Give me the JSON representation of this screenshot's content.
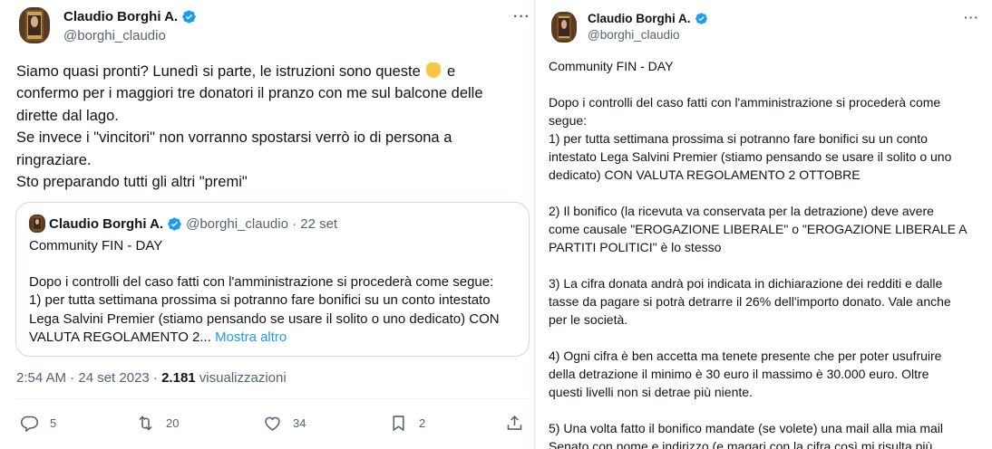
{
  "main_tweet": {
    "author": {
      "name": "Claudio Borghi A.",
      "handle": "@borghi_claudio"
    },
    "more_label": "···",
    "text_lines": [
      "Siamo quasi pronti? Lunedì si parte, le istruzioni sono queste",
      "e",
      "confermo per i maggiori tre donatori il pranzo con me sul balcone delle",
      "dirette dal lago.",
      "Se invece i \"vincitori\" non vorranno spostarsi verrò io di persona a",
      "ringraziare.",
      "Sto preparando tutti gli altri \"premi\""
    ],
    "quote": {
      "name": "Claudio Borghi A.",
      "meta": "@borghi_claudio · 22 set",
      "title": "Community FIN - DAY",
      "lines": [
        "Dopo i controlli del caso fatti con l'amministrazione si procederà come segue:",
        "1) per tutta settimana prossima si potranno fare bonifici su un conto intestato",
        "Lega Salvini Premier (stiamo pensando se usare il solito o uno dedicato) CON",
        "VALUTA REGOLAMENTO 2..."
      ],
      "show_more": "Mostra altro"
    },
    "meta": {
      "time": "2:54 AM · 24 set 2023 · ",
      "views_count": "2.181",
      "views_label": " visualizzazioni"
    },
    "actions": {
      "replies": "5",
      "reposts": "20",
      "likes": "34",
      "bookmarks": "2"
    }
  },
  "detail_tweet": {
    "author": {
      "name": "Claudio Borghi A.",
      "handle": "@borghi_claudio"
    },
    "more_label": "···",
    "lines": [
      "Community FIN - DAY",
      "",
      "Dopo i controlli del caso fatti con l'amministrazione si procederà come",
      "segue:",
      "1) per tutta settimana prossima si potranno fare bonifici su un conto",
      "intestato Lega Salvini Premier (stiamo pensando se usare il solito o uno",
      "dedicato) CON VALUTA REGOLAMENTO 2 OTTOBRE",
      "",
      "2) Il bonifico (la ricevuta va conservata per la detrazione) deve avere",
      "come causale \"EROGAZIONE LIBERALE\" o \"EROGAZIONE LIBERALE A",
      "PARTITI POLITICI\" è lo stesso",
      "",
      "3) La cifra donata andrà poi indicata in dichiarazione dei redditi e dalle",
      "tasse da pagare si potrà detrarre il 26% dell'importo donato. Vale anche",
      "per le società.",
      "",
      "4) Ogni cifra è ben accetta ma tenete presente che per poter usufruire",
      "della detrazione il minimo è 30 euro il massimo è 30.000 euro. Oltre",
      "questi livelli non si detrae più niente.",
      "",
      "5) Una volta fatto il bonifico mandate (se volete) una mail alla mia mail",
      "Senato con nome e indirizzo (e magari con la cifra così mi risulta più"
    ]
  },
  "colors": {
    "accent": "#1d9bf0",
    "muted": "#536471",
    "text": "#0f1419",
    "border": "#cfd9de"
  }
}
